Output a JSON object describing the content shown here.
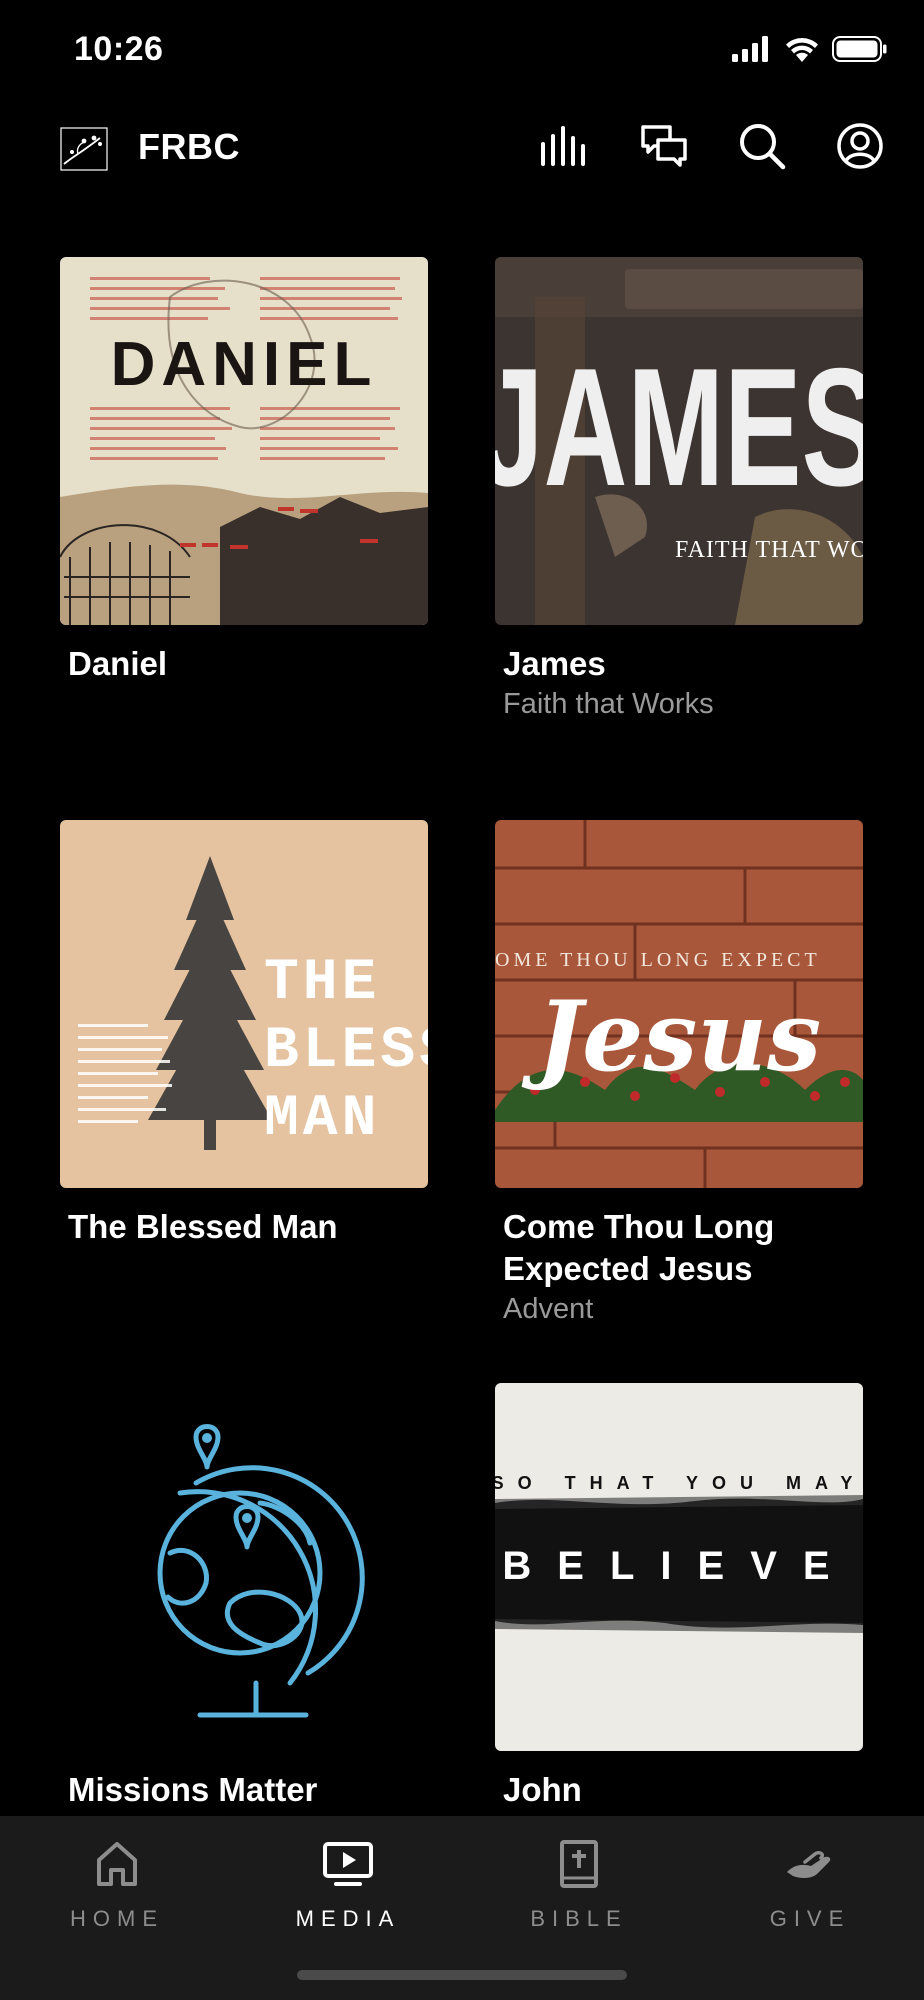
{
  "status": {
    "time": "10:26"
  },
  "header": {
    "brand": "FRBC"
  },
  "media": [
    {
      "title": "Daniel",
      "subtitle": "",
      "art_word": "DANIEL"
    },
    {
      "title": "James",
      "subtitle": "Faith that Works",
      "art_word": "JAMES",
      "art_tagline": "FAITH THAT WO"
    },
    {
      "title": "The Blessed Man",
      "subtitle": "",
      "art_lines": [
        "THE",
        "BLESS",
        "MAN"
      ]
    },
    {
      "title": "Come Thou Long Expected Jesus",
      "subtitle": "Advent",
      "art_tagline": "OME THOU LONG EXPECT",
      "art_word": "Jesus"
    },
    {
      "title": "Missions Matter",
      "subtitle": ""
    },
    {
      "title": "John",
      "subtitle": "",
      "art_tagline": "SO THAT YOU MAY",
      "art_word": "BELIEVE"
    }
  ],
  "tabs": [
    {
      "label": "HOME",
      "active": false
    },
    {
      "label": "MEDIA",
      "active": true
    },
    {
      "label": "BIBLE",
      "active": false
    },
    {
      "label": "GIVE",
      "active": false
    }
  ],
  "colors": {
    "background": "#000000",
    "tabbar": "#1b1b1b",
    "subtitle": "#9a9a9a",
    "globe": "#5ab3dd"
  }
}
